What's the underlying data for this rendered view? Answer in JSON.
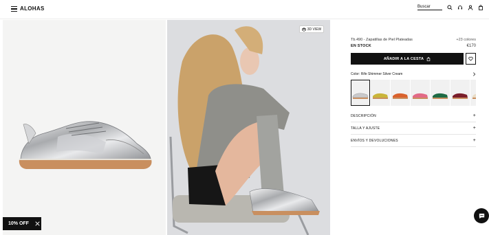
{
  "header": {
    "logo": "ALOHAS",
    "search_label": "Buscar",
    "icons": [
      "menu-icon",
      "search-icon",
      "headset-icon",
      "user-icon",
      "bag-icon"
    ]
  },
  "gallery": {
    "view3d_label": "3D VIEW"
  },
  "promo": {
    "discount_label": "10% OFF"
  },
  "product": {
    "name": "Tb.490 - Zapatillas de Piel Plateadas",
    "colors_count": "+23 colores",
    "stock": "EN STOCK",
    "price": "€170",
    "add_to_cart": "AÑADIR A LA CESTA",
    "color_label": "Color: Rife Shimmer Silver Cream",
    "swatches": [
      {
        "name": "silver",
        "color": "#c9c9cb"
      },
      {
        "name": "yellow",
        "color": "#c9b53a"
      },
      {
        "name": "orange",
        "color": "#d9622d"
      },
      {
        "name": "pink",
        "color": "#e26a86"
      },
      {
        "name": "green",
        "color": "#1f6b45"
      },
      {
        "name": "burgundy",
        "color": "#7a1e2b"
      },
      {
        "name": "cream",
        "color": "#e9dcc6"
      }
    ]
  },
  "accordion": [
    {
      "label": "DESCRIPCIÓN"
    },
    {
      "label": "TALLA Y AJUSTE"
    },
    {
      "label": "ENVÍOS Y DEVOLUCIONES"
    }
  ],
  "colors": {
    "accent": "#111111",
    "sole": "#c98f5f"
  }
}
